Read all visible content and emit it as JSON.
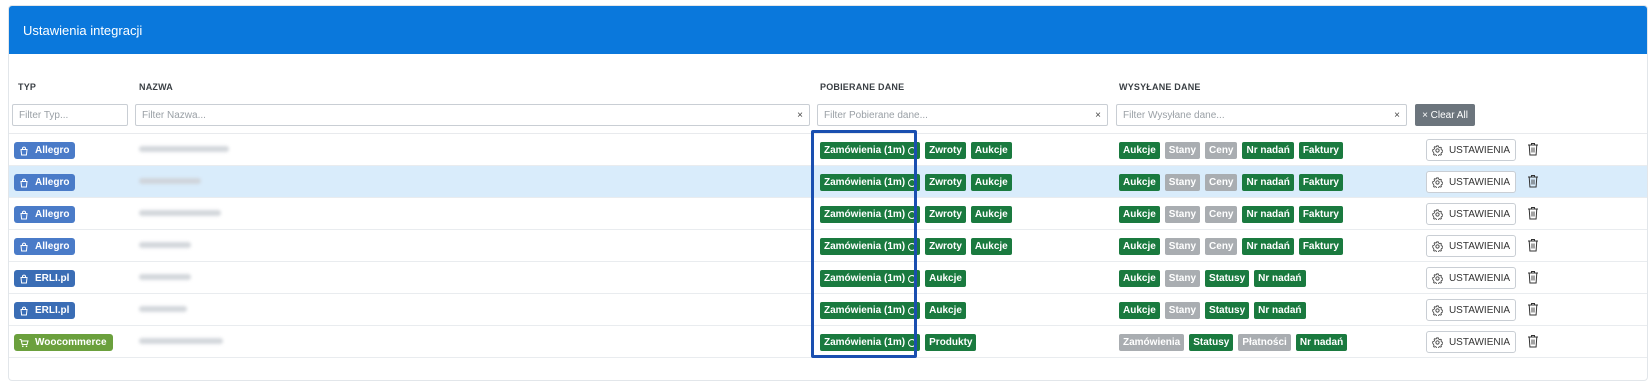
{
  "panel": {
    "title": "Ustawienia integracji"
  },
  "columns": {
    "typ": "TYP",
    "nazwa": "NAZWA",
    "pobierane": "POBIERANE DANE",
    "wysylane": "WYSYŁANE DANE"
  },
  "filters": {
    "typ": "Filter Typ...",
    "nazwa": "Filter Nazwa...",
    "pobierane": "Filter Pobierane dane...",
    "wysylane": "Filter Wysyłane dane...",
    "clear_icon": "×",
    "clear_all": "× Clear All"
  },
  "actions": {
    "settings_label": "USTAWIENIA"
  },
  "colors": {
    "allegro": "#4a7bc8",
    "erli": "#3a6db5",
    "woocommerce": "#6ba03d",
    "tag_on": "#1a7a3f",
    "tag_off": "#a9adb1"
  },
  "rows": [
    {
      "type": "Allegro",
      "type_icon": "bag-icon",
      "type_color": "#4a7bc8",
      "selected": false,
      "pobierane": [
        {
          "label": "Zamówienia (1m)",
          "on": true,
          "cycle": true
        },
        {
          "label": "Zwroty",
          "on": true
        },
        {
          "label": "Aukcje",
          "on": true
        }
      ],
      "wysylane": [
        {
          "label": "Aukcje",
          "on": true
        },
        {
          "label": "Stany",
          "on": false
        },
        {
          "label": "Ceny",
          "on": false
        },
        {
          "label": "Nr nadań",
          "on": true
        },
        {
          "label": "Faktury",
          "on": true
        }
      ]
    },
    {
      "type": "Allegro",
      "type_icon": "bag-icon",
      "type_color": "#4a7bc8",
      "selected": true,
      "pobierane": [
        {
          "label": "Zamówienia (1m)",
          "on": true,
          "cycle": true
        },
        {
          "label": "Zwroty",
          "on": true
        },
        {
          "label": "Aukcje",
          "on": true
        }
      ],
      "wysylane": [
        {
          "label": "Aukcje",
          "on": true
        },
        {
          "label": "Stany",
          "on": false
        },
        {
          "label": "Ceny",
          "on": false
        },
        {
          "label": "Nr nadań",
          "on": true
        },
        {
          "label": "Faktury",
          "on": true
        }
      ]
    },
    {
      "type": "Allegro",
      "type_icon": "bag-icon",
      "type_color": "#4a7bc8",
      "selected": false,
      "pobierane": [
        {
          "label": "Zamówienia (1m)",
          "on": true,
          "cycle": true
        },
        {
          "label": "Zwroty",
          "on": true
        },
        {
          "label": "Aukcje",
          "on": true
        }
      ],
      "wysylane": [
        {
          "label": "Aukcje",
          "on": true
        },
        {
          "label": "Stany",
          "on": false
        },
        {
          "label": "Ceny",
          "on": false
        },
        {
          "label": "Nr nadań",
          "on": true
        },
        {
          "label": "Faktury",
          "on": true
        }
      ]
    },
    {
      "type": "Allegro",
      "type_icon": "bag-icon",
      "type_color": "#4a7bc8",
      "selected": false,
      "pobierane": [
        {
          "label": "Zamówienia (1m)",
          "on": true,
          "cycle": true
        },
        {
          "label": "Zwroty",
          "on": true
        },
        {
          "label": "Aukcje",
          "on": true
        }
      ],
      "wysylane": [
        {
          "label": "Aukcje",
          "on": true
        },
        {
          "label": "Stany",
          "on": false
        },
        {
          "label": "Ceny",
          "on": false
        },
        {
          "label": "Nr nadań",
          "on": true
        },
        {
          "label": "Faktury",
          "on": true
        }
      ]
    },
    {
      "type": "ERLI.pl",
      "type_icon": "bag-icon",
      "type_color": "#3a6db5",
      "selected": false,
      "pobierane": [
        {
          "label": "Zamówienia (1m)",
          "on": true,
          "cycle": true
        },
        {
          "label": "Aukcje",
          "on": true
        }
      ],
      "wysylane": [
        {
          "label": "Aukcje",
          "on": true
        },
        {
          "label": "Stany",
          "on": false
        },
        {
          "label": "Statusy",
          "on": true
        },
        {
          "label": "Nr nadań",
          "on": true
        }
      ]
    },
    {
      "type": "ERLI.pl",
      "type_icon": "bag-icon",
      "type_color": "#3a6db5",
      "selected": false,
      "pobierane": [
        {
          "label": "Zamówienia (1m)",
          "on": true,
          "cycle": true
        },
        {
          "label": "Aukcje",
          "on": true
        }
      ],
      "wysylane": [
        {
          "label": "Aukcje",
          "on": true
        },
        {
          "label": "Stany",
          "on": false
        },
        {
          "label": "Statusy",
          "on": true
        },
        {
          "label": "Nr nadań",
          "on": true
        }
      ]
    },
    {
      "type": "Woocommerce",
      "type_icon": "cart-icon",
      "type_color": "#6ba03d",
      "selected": false,
      "pobierane": [
        {
          "label": "Zamówienia (1m)",
          "on": true,
          "cycle": true
        },
        {
          "label": "Produkty",
          "on": true
        }
      ],
      "wysylane": [
        {
          "label": "Zamówienia",
          "on": false
        },
        {
          "label": "Statusy",
          "on": true
        },
        {
          "label": "Płatności",
          "on": false
        },
        {
          "label": "Nr nadań",
          "on": true
        }
      ]
    }
  ]
}
